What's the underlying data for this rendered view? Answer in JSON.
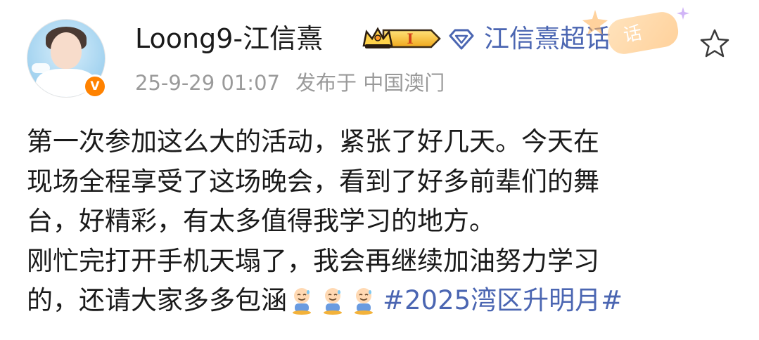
{
  "author": {
    "name": "Loong9-江信熹",
    "avatar_icon": "user-avatar",
    "verified_badge": "V",
    "level_badge": "I",
    "supertopic": "江信熹超话",
    "sticker_text": "话",
    "follow_icon": "star-outline-icon"
  },
  "meta": {
    "timestamp": "25-9-29 01:07",
    "location": "发布于 中国澳门"
  },
  "post": {
    "lines": [
      "第一次参加这么大的活动，紧张了好几天。今天在",
      "现场全程享受了这场晚会，看到了好多前辈们的舞",
      "台，好精彩，有太多值得我学习的地方。",
      "刚忙完打开手机天塌了，我会再继续加油努力学习",
      "的，还请大家多多包涵"
    ],
    "emoji_count": 3,
    "emoji_icon": "sweat-smile-baby-emoji",
    "hashtag": "#2025湾区升明月#"
  },
  "colors": {
    "link": "#4b66b2",
    "meta_text": "#9a9a9a",
    "verified": "#ff8200",
    "badge_gold": "#f6c23e"
  }
}
